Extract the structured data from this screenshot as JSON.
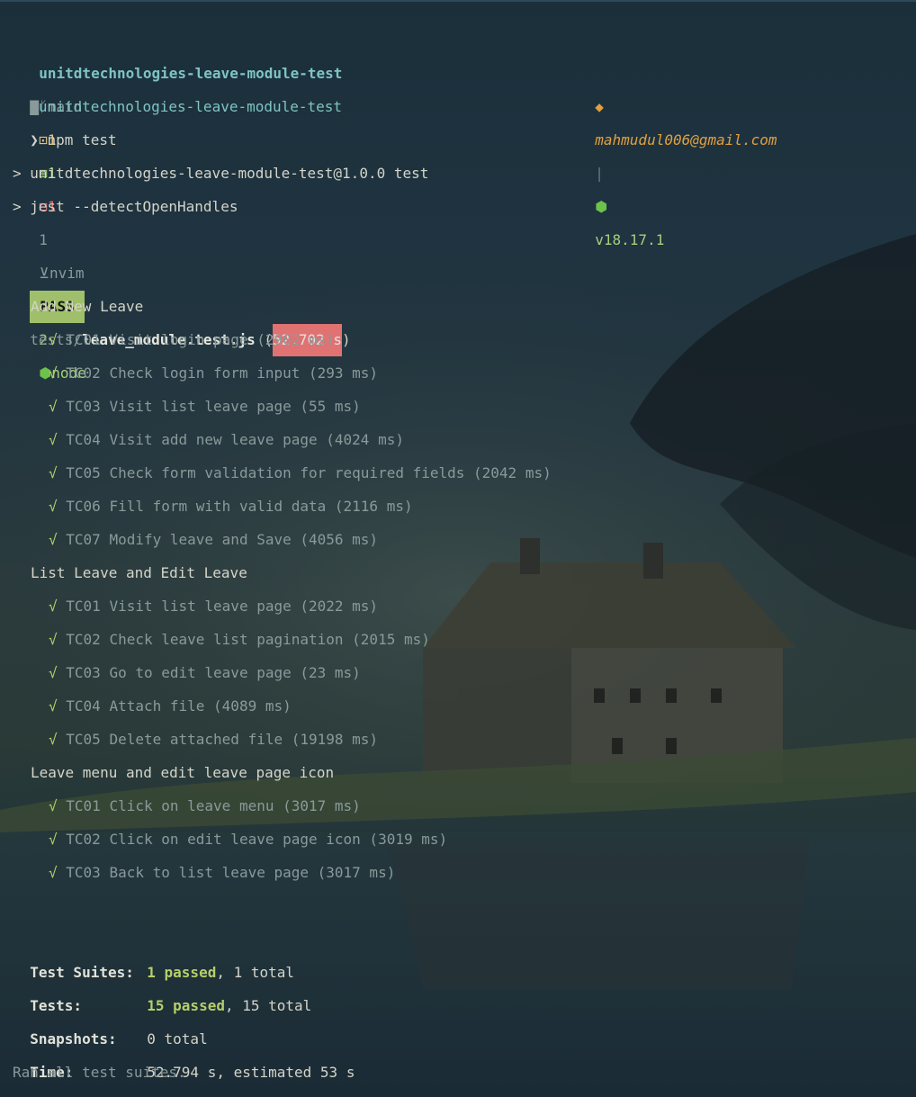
{
  "prompt": {
    "dir": "unitdtechnologies-leave-module-test",
    "branch": "main",
    "git_staged": "1",
    "git_added": "1",
    "git_deleted": "1",
    "git_other": "1",
    "editor": "nvim",
    "jobs": "2",
    "runtime": "node"
  },
  "prompt2": {
    "dir": "unitdtechnologies-leave-module-test",
    "email": "mahmudul006@gmail.com",
    "node_version": "v18.17.1"
  },
  "command": "npm test",
  "npm_header_1": "> unitdtechnologies-leave-module-test@1.0.0 test",
  "npm_header_2": "> jest --detectOpenHandles",
  "result": {
    "badge": "PASS",
    "path_prefix": "tests/",
    "file": "leave_module.test.js",
    "time": "52.702 s"
  },
  "suites": [
    {
      "name": "Add New Leave",
      "tests": [
        "TC01 Visit login page (2902 ms)",
        "TC02 Check login form input (293 ms)",
        "TC03 Visit list leave page (55 ms)",
        "TC04 Visit add new leave page (4024 ms)",
        "TC05 Check form validation for required fields (2042 ms)",
        "TC06 Fill form with valid data (2116 ms)",
        "TC07 Modify leave and Save (4056 ms)"
      ]
    },
    {
      "name": "List Leave and Edit Leave",
      "tests": [
        "TC01 Visit list leave page (2022 ms)",
        "TC02 Check leave list pagination (2015 ms)",
        "TC03 Go to edit leave page (23 ms)",
        "TC04 Attach file (4089 ms)",
        "TC05 Delete attached file (19198 ms)"
      ]
    },
    {
      "name": "Leave menu and edit leave page icon",
      "tests": [
        "TC01 Click on leave menu (3017 ms)",
        "TC02 Click on edit leave page icon (3019 ms)",
        "TC03 Back to list leave page (3017 ms)"
      ]
    }
  ],
  "check_mark": "√",
  "summary": {
    "suites_label": "Test Suites:",
    "suites_passed": "1 passed",
    "suites_total": ", 1 total",
    "tests_label": "Tests:",
    "tests_passed": "15 passed",
    "tests_total": ", 15 total",
    "snapshots_label": "Snapshots:",
    "snapshots_value": "0 total",
    "time_label": "Time:",
    "time_value": "52.794 s, estimated 53 s",
    "footer": "Ran all test suites."
  },
  "colors": {
    "pass_badge": "#9fbf6a",
    "time_highlight": "#e07272",
    "check": "#b5cf6a",
    "dir": "#7fc3c3"
  }
}
